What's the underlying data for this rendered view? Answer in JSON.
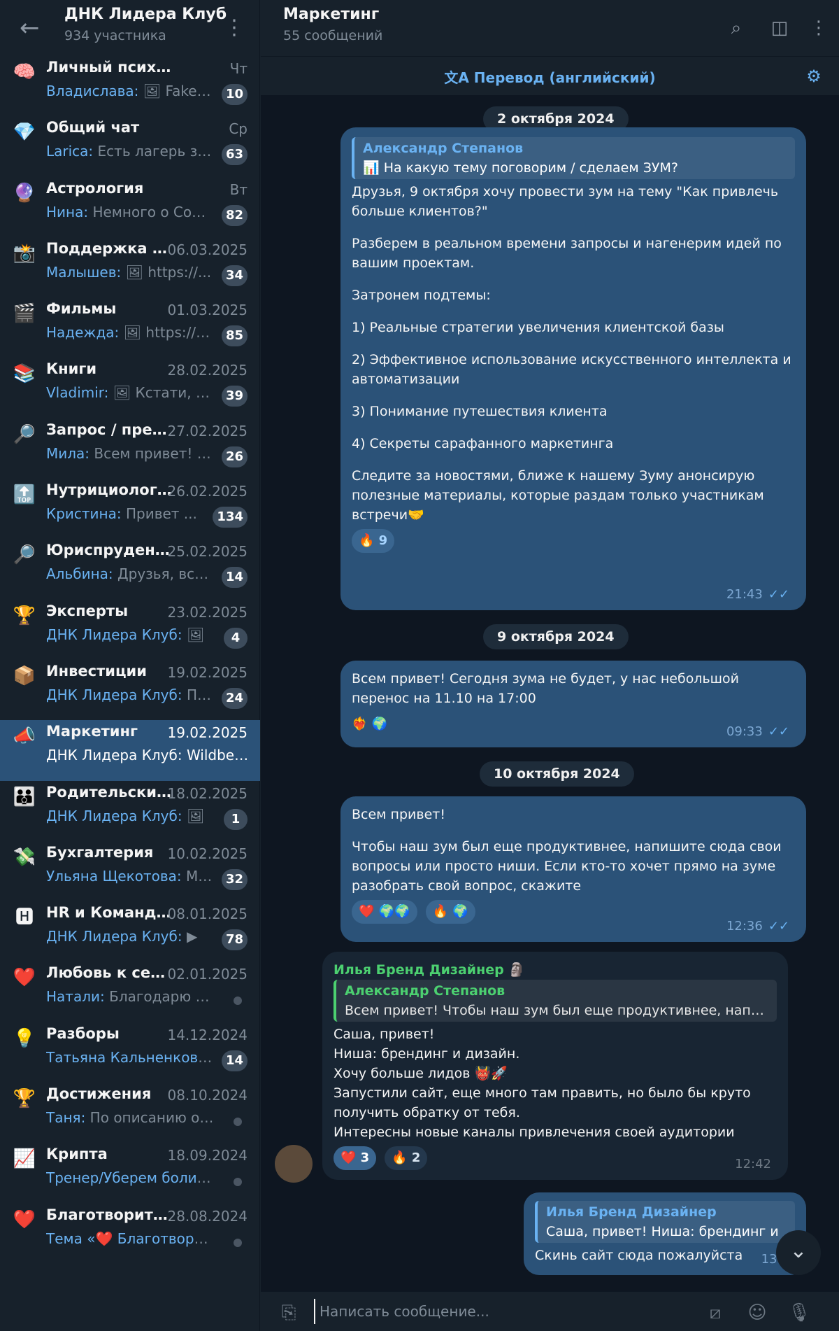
{
  "sidebar": {
    "group_title": "ДНК Лидера Клуб",
    "group_sub": "934 участника",
    "topics": [
      {
        "icon": "🧠",
        "name": "Личный психолог",
        "date": "Чт",
        "author": "Владислава:",
        "preview": " 🖼 Fake it...",
        "badge": "10"
      },
      {
        "icon": "💎",
        "name": "Общий чат",
        "date": "Ср",
        "author": "Larica:",
        "preview": " Есть лагерь зам...",
        "badge": "63"
      },
      {
        "icon": "🔮",
        "name": "Астрология",
        "date": "Вт",
        "author": "Нина:",
        "preview": " Немного о Соля...",
        "badge": "82"
      },
      {
        "icon": "📸",
        "name": "Поддержка , ла...",
        "date": "06.03.2025",
        "author": "Малышев:",
        "preview": " 🖼 https://...",
        "badge": "34"
      },
      {
        "icon": "🎬",
        "name": "Фильмы",
        "date": "01.03.2025",
        "author": "Надежда:",
        "preview": " 🖼 https://w...",
        "badge": "85"
      },
      {
        "icon": "📚",
        "name": "Книги",
        "date": "28.02.2025",
        "author": "Vladimir:",
        "preview": " 🖼 Кстати, ко...",
        "badge": "39"
      },
      {
        "icon": "🔎",
        "name": "Запрос / предл...",
        "date": "27.02.2025",
        "author": "Мила:",
        "preview": " Всем привет! И...",
        "badge": "26"
      },
      {
        "icon": "🔝",
        "name": "Нутрициологи...",
        "date": "26.02.2025",
        "author": "Кристина:",
        "preview": " Привет ...",
        "badge": "134"
      },
      {
        "icon": "🔎",
        "name": "Юриспруденция",
        "date": "25.02.2025",
        "author": "Альбина:",
        "preview": " Друзья, всем...",
        "badge": "14"
      },
      {
        "icon": "🏆",
        "name": "Эксперты",
        "date": "23.02.2025",
        "author": "ДНК Лидера Клуб:",
        "preview": " 🖼",
        "badge": "4"
      },
      {
        "icon": "📦",
        "name": "Инвестиции",
        "date": "19.02.2025",
        "author": "ДНК Лидера Клуб:",
        "preview": " Про...",
        "badge": "24"
      },
      {
        "icon": "📣",
        "name": "Маркетинг",
        "date": "19.02.2025",
        "author": "ДНК Лидера Клуб:",
        "preview": " Wildberr...",
        "badge": ""
      },
      {
        "icon": "👪",
        "name": "Родительский ...",
        "date": "18.02.2025",
        "author": "ДНК Лидера Клуб:",
        "preview": " 🖼",
        "badge": "1"
      },
      {
        "icon": "💸",
        "name": "Бухгалтерия",
        "date": "10.02.2025",
        "author": "Ульяна Щекотова:",
        "preview": " Мог...",
        "badge": "32"
      },
      {
        "icon": "🅷",
        "name": "HR и Командоо...",
        "date": "08.01.2025",
        "author": "ДНК Лидера Клуб:",
        "preview": " ▶",
        "badge": "78"
      },
      {
        "icon": "❤️",
        "name": "Любовь к себе ...",
        "date": "02.01.2025",
        "author": "Натали:",
        "preview": " Благодарю себ...",
        "badge": ""
      },
      {
        "icon": "💡",
        "name": "Разборы",
        "date": "14.12.2024",
        "author": "Татьяна Кальненкова:",
        "preview": "...",
        "badge": "14"
      },
      {
        "icon": "🏆",
        "name": "Достижения",
        "date": "08.10.2024",
        "author": "Таня:",
        "preview": " По описанию очень ...",
        "badge": ""
      },
      {
        "icon": "📈",
        "name": "Крипта",
        "date": "18.09.2024",
        "author": "Тренер/Уберем боли в ...",
        "preview": "",
        "badge": ""
      },
      {
        "icon": "❤️",
        "name": "Благотворител...",
        "date": "28.08.2024",
        "author": "Тема «❤️ Благотворитель...",
        "preview": "",
        "badge": ""
      }
    ]
  },
  "chat": {
    "title": "Маркетинг",
    "subtitle": "55 сообщений",
    "translate": "Перевод (английский)",
    "dates": [
      "2 октября 2024",
      "9 октября 2024",
      "10 октября 2024"
    ],
    "m1": {
      "reply_author": "Александр Степанов",
      "reply_text": "📊 На какую тему поговорим / сделаем ЗУМ?",
      "lines": [
        "Друзья, 9 октября хочу провести зум на тему \"Как привлечь больше клиентов?\"",
        "",
        "Разберем в реальном времени запросы и нагенерим идей по вашим проектам.",
        "",
        "Затронем подтемы:",
        "",
        "1) Реальные стратегии увеличения клиентской базы",
        "",
        "2) Эффективное использование искусственного интеллекта и автоматизации",
        "",
        "3) Понимание путешествия клиента",
        "",
        "4) Секреты сарафанного маркетинга",
        "",
        "Следите за новостями, ближе к нашему Зуму анонсирую полезные материалы, которые раздам только участникам встречи🤝"
      ],
      "reaction": "🔥 9",
      "time": "21:43"
    },
    "m2": {
      "text": "Всем привет! Сегодня зума не будет, у нас небольшой перенос на 11.10 на 17:00",
      "reaction": "❤️‍🔥 🌍",
      "time": "09:33"
    },
    "m3": {
      "lines": [
        "Всем привет!",
        "",
        "Чтобы наш зум был еще продуктивнее, напишите сюда свои вопросы или просто ниши. Если кто-то хочет прямо на зуме разобрать свой вопрос, скажите"
      ],
      "reaction1": "❤️ 🌍🌍",
      "reaction2": "🔥 🌍",
      "time": "12:36"
    },
    "m4": {
      "sender": "Илья Бренд Дизайнер 🗿",
      "reply_author": "Александр Степанов",
      "reply_text": "Всем привет!   Чтобы наш зум был еще продуктивнее, напи...",
      "lines": [
        "Саша, привет!",
        "Ниша: брендинг и дизайн.",
        "Хочу больше лидов 👹🚀",
        "Запустили сайт, еще много там править, но было бы круто получить обратку от тебя.",
        "Интересны новые каналы привлечения своей аудитории"
      ],
      "reaction1": "❤️ 3",
      "reaction2": "🔥 2",
      "time": "12:42"
    },
    "m5": {
      "reply_author": "Илья Бренд Дизайнер",
      "reply_text": "Саша, привет!  Ниша: брендинг и",
      "text": "Скинь сайт сюда пожалуйста",
      "time": "13:3"
    },
    "composer_placeholder": "Написать сообщение..."
  }
}
